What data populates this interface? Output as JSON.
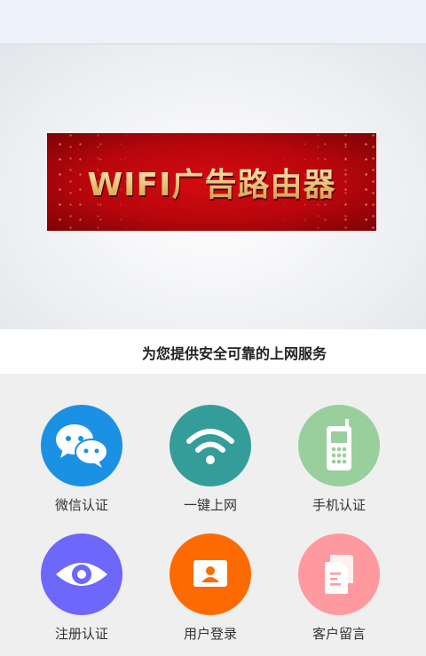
{
  "header": {
    "bar_color": "#eef2fb"
  },
  "banner": {
    "text": "WIFI广告路由器",
    "bg_color": "#c8080e",
    "text_color": "#e9c37a"
  },
  "slogan": "为您提供安全可靠的上网服务",
  "menu": {
    "items": [
      {
        "label": "微信认证",
        "icon": "wechat-icon",
        "color": "#1a91e3"
      },
      {
        "label": "一键上网",
        "icon": "wifi-icon",
        "color": "#349d9a"
      },
      {
        "label": "手机认证",
        "icon": "mobile-phone-icon",
        "color": "#99cf9c"
      },
      {
        "label": "注册认证",
        "icon": "eye-icon",
        "color": "#6d67fb"
      },
      {
        "label": "用户登录",
        "icon": "user-card-icon",
        "color": "#fd6a02"
      },
      {
        "label": "客户留言",
        "icon": "document-icon",
        "color": "#fe9a9f"
      }
    ]
  }
}
